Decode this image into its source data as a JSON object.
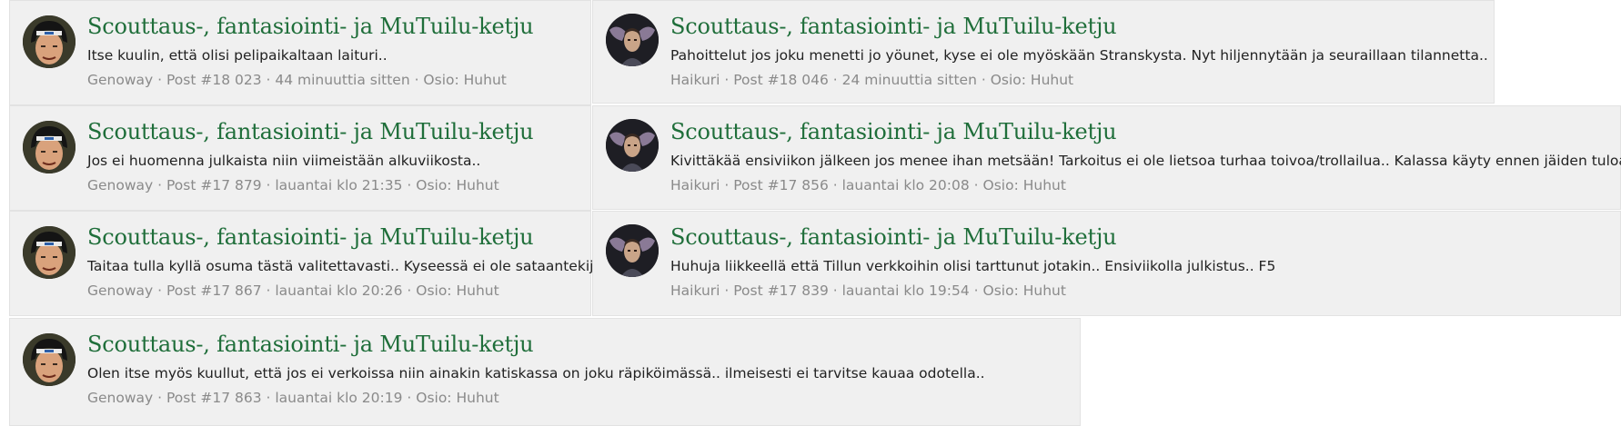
{
  "thread_title": "Scouttaus-, fantasiointi- ja MuTuilu-ketju",
  "avatars": {
    "genoway": "hockey-player-avatar",
    "haikuri": "winged-face-avatar"
  },
  "left_posts": [
    {
      "snippet": "Itse kuulin, että olisi pelipaikaltaan laituri..",
      "meta": "Genoway · Post #18 023 · 44 minuuttia sitten · Osio: Huhut"
    },
    {
      "snippet": "Jos ei huomenna julkaista niin viimeistään alkuviikosta..",
      "meta": "Genoway · Post #17 879 · lauantai klo 21:35 · Osio: Huhut"
    },
    {
      "snippet": "Taitaa tulla kyllä osuma tästä valitettavasti.. Kyseessä ei ole sataantekijä",
      "meta": "Genoway · Post #17 867 · lauantai klo 20:26 · Osio: Huhut"
    },
    {
      "snippet": "Olen itse myös kuullut, että jos ei verkoissa niin ainakin katiskassa on joku räpiköimässä.. ilmeisesti ei tarvitse kauaa odotella..",
      "meta": "Genoway · Post #17 863 · lauantai klo 20:19 · Osio: Huhut"
    }
  ],
  "right_posts": [
    {
      "snippet": "Pahoittelut jos joku menetti jo yöunet, kyse ei ole myöskään Stranskysta. Nyt hiljennytään ja seuraillaan tilannetta..",
      "meta": "Haikuri · Post #18 046 · 24 minuuttia sitten · Osio: Huhut"
    },
    {
      "snippet": "Kivittäkää ensiviikon jälkeen jos menee ihan metsään! Tarkoitus ei ole lietsoa turhaa toivoa/trollailua.. Kalassa käyty ennen jäiden tuloa..",
      "meta": "Haikuri · Post #17 856 · lauantai klo 20:08 · Osio: Huhut"
    },
    {
      "snippet": "Huhuja liikkeellä että Tillun verkkoihin olisi tarttunut jotakin.. Ensiviikolla julkistus.. F5",
      "meta": "Haikuri · Post #17 839 · lauantai klo 19:54 · Osio: Huhut"
    }
  ]
}
